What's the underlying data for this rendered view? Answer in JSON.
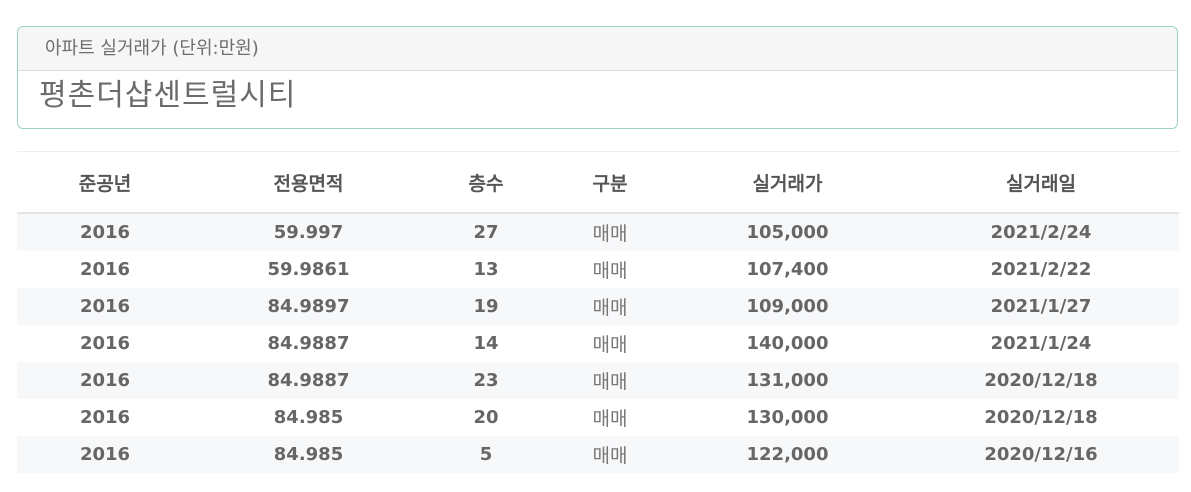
{
  "card": {
    "header": "아파트 실거래가 (단위:만원)",
    "title": "평촌더샵센트럴시티"
  },
  "table": {
    "columns": [
      "준공년",
      "전용면적",
      "층수",
      "구분",
      "실거래가",
      "실거래일"
    ],
    "rows": [
      [
        "2016",
        "59.997",
        "27",
        "매매",
        "105,000",
        "2021/2/24"
      ],
      [
        "2016",
        "59.9861",
        "13",
        "매매",
        "107,400",
        "2021/2/22"
      ],
      [
        "2016",
        "84.9897",
        "19",
        "매매",
        "109,000",
        "2021/1/27"
      ],
      [
        "2016",
        "84.9887",
        "14",
        "매매",
        "140,000",
        "2021/1/24"
      ],
      [
        "2016",
        "84.9887",
        "23",
        "매매",
        "131,000",
        "2020/12/18"
      ],
      [
        "2016",
        "84.985",
        "20",
        "매매",
        "130,000",
        "2020/12/18"
      ],
      [
        "2016",
        "84.985",
        "5",
        "매매",
        "122,000",
        "2020/12/16"
      ]
    ]
  }
}
